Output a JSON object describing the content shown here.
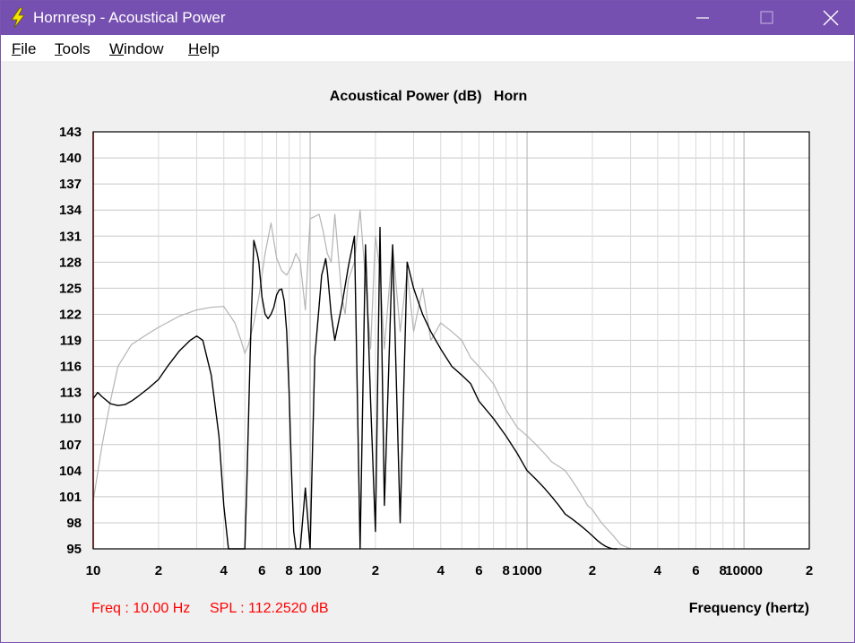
{
  "window": {
    "title": "Hornresp - Acoustical Power",
    "accent": "#7650b0"
  },
  "menu": [
    {
      "label": "File",
      "hotkey": "F",
      "rest": "ile"
    },
    {
      "label": "Tools",
      "hotkey": "T",
      "rest": "ools"
    },
    {
      "label": "Window",
      "hotkey": "W",
      "rest": "indow"
    },
    {
      "label": "Help",
      "hotkey": "H",
      "rest": "elp"
    }
  ],
  "status": {
    "freq": "Freq : 10.00 Hz",
    "spl": "SPL : 112.2520 dB"
  },
  "chart_data": {
    "type": "line",
    "title": "Acoustical Power (dB)   Horn",
    "xlabel": "Frequency (hertz)",
    "x_scale": "log",
    "xlim": [
      10,
      20000
    ],
    "ylim": [
      95,
      143
    ],
    "y_ticks": [
      95,
      98,
      101,
      104,
      107,
      110,
      113,
      116,
      119,
      122,
      125,
      128,
      131,
      134,
      137,
      140,
      143
    ],
    "x_ticks": [
      {
        "value": 10,
        "label": "10"
      },
      {
        "value": 20,
        "label": "2"
      },
      {
        "value": 40,
        "label": "4"
      },
      {
        "value": 60,
        "label": "6"
      },
      {
        "value": 80,
        "label": "8"
      },
      {
        "value": 100,
        "label": "100"
      },
      {
        "value": 200,
        "label": "2"
      },
      {
        "value": 400,
        "label": "4"
      },
      {
        "value": 600,
        "label": "6"
      },
      {
        "value": 800,
        "label": "8"
      },
      {
        "value": 1000,
        "label": "1000"
      },
      {
        "value": 2000,
        "label": "2"
      },
      {
        "value": 4000,
        "label": "4"
      },
      {
        "value": 6000,
        "label": "6"
      },
      {
        "value": 8000,
        "label": "8"
      },
      {
        "value": 10000,
        "label": "10000"
      },
      {
        "value": 20000,
        "label": "2"
      }
    ],
    "cursor_x": 10,
    "grid": true,
    "series": [
      {
        "color": "#b4b4b4",
        "x": [
          10,
          11,
          12,
          13,
          15,
          18,
          20,
          25,
          30,
          35,
          40,
          45,
          48,
          50,
          52,
          55,
          58,
          62,
          66,
          70,
          74,
          78,
          82,
          86,
          90,
          95,
          100,
          110,
          115,
          120,
          125,
          130,
          140,
          145,
          150,
          160,
          170,
          180,
          190,
          200,
          210,
          220,
          240,
          260,
          280,
          300,
          330,
          360,
          400,
          450,
          500,
          550,
          600,
          700,
          800,
          900,
          1000,
          1100,
          1200,
          1300,
          1400,
          1500,
          1600,
          1700,
          1800,
          1900,
          2000,
          2200,
          2500,
          2700,
          3000
        ],
        "y": [
          100.5,
          107,
          112,
          116,
          118.5,
          119.8,
          120.5,
          121.8,
          122.5,
          122.8,
          122.9,
          121,
          119,
          117.5,
          118.5,
          121,
          124,
          129,
          132.5,
          128.5,
          127,
          126.5,
          127.5,
          129,
          128,
          122.5,
          133,
          133.5,
          131.5,
          129,
          128,
          133.5,
          124,
          122,
          126,
          128,
          134,
          126,
          118,
          131,
          127,
          118,
          130,
          120,
          127,
          120,
          125,
          119,
          121,
          120,
          119,
          117,
          116,
          114,
          111,
          109,
          108,
          107,
          106,
          105,
          104.5,
          104,
          103,
          102,
          101,
          100,
          99.5,
          98,
          96.5,
          95.5,
          95
        ]
      },
      {
        "color": "#000000",
        "x": [
          10,
          10.5,
          11,
          12,
          13,
          14,
          15,
          16,
          18,
          20,
          22,
          25,
          28,
          30,
          32,
          35,
          38,
          40,
          42,
          45,
          48,
          50,
          51,
          52,
          53,
          55,
          57,
          58,
          60,
          62,
          64,
          66,
          68,
          70,
          72,
          74,
          76,
          78,
          80,
          82,
          84,
          86,
          88,
          90,
          95,
          100,
          105,
          110,
          113,
          115,
          118,
          120,
          125,
          130,
          140,
          150,
          160,
          170,
          180,
          190,
          200,
          210,
          220,
          240,
          260,
          280,
          300,
          330,
          360,
          400,
          450,
          500,
          550,
          600,
          700,
          800,
          900,
          1000,
          1100,
          1200,
          1300,
          1400,
          1500,
          1600,
          1700,
          1800,
          1900,
          2000,
          2100,
          2200,
          2300,
          2400,
          2500,
          2600
        ],
        "y": [
          112.3,
          113,
          112.5,
          111.7,
          111.5,
          111.6,
          112,
          112.5,
          113.5,
          114.5,
          116,
          117.8,
          119,
          119.5,
          119,
          115,
          108,
          100,
          95,
          95,
          95,
          95,
          102,
          110,
          118,
          130.5,
          129,
          128,
          124,
          122,
          121.5,
          122,
          122.8,
          124.2,
          124.8,
          124.9,
          123.5,
          120,
          113,
          104,
          97,
          95,
          95,
          95,
          102,
          95,
          117,
          123,
          126.5,
          127.2,
          128.4,
          127,
          122,
          119,
          123,
          127.5,
          131,
          95,
          130,
          112,
          97,
          132,
          100,
          130,
          98,
          128,
          125,
          122,
          120,
          118,
          116,
          115,
          114,
          112,
          110,
          108,
          106,
          104,
          103,
          102,
          101,
          100,
          99,
          98.5,
          98,
          97.5,
          97,
          96.5,
          96,
          95.6,
          95.3,
          95.1,
          95,
          95
        ]
      }
    ]
  }
}
